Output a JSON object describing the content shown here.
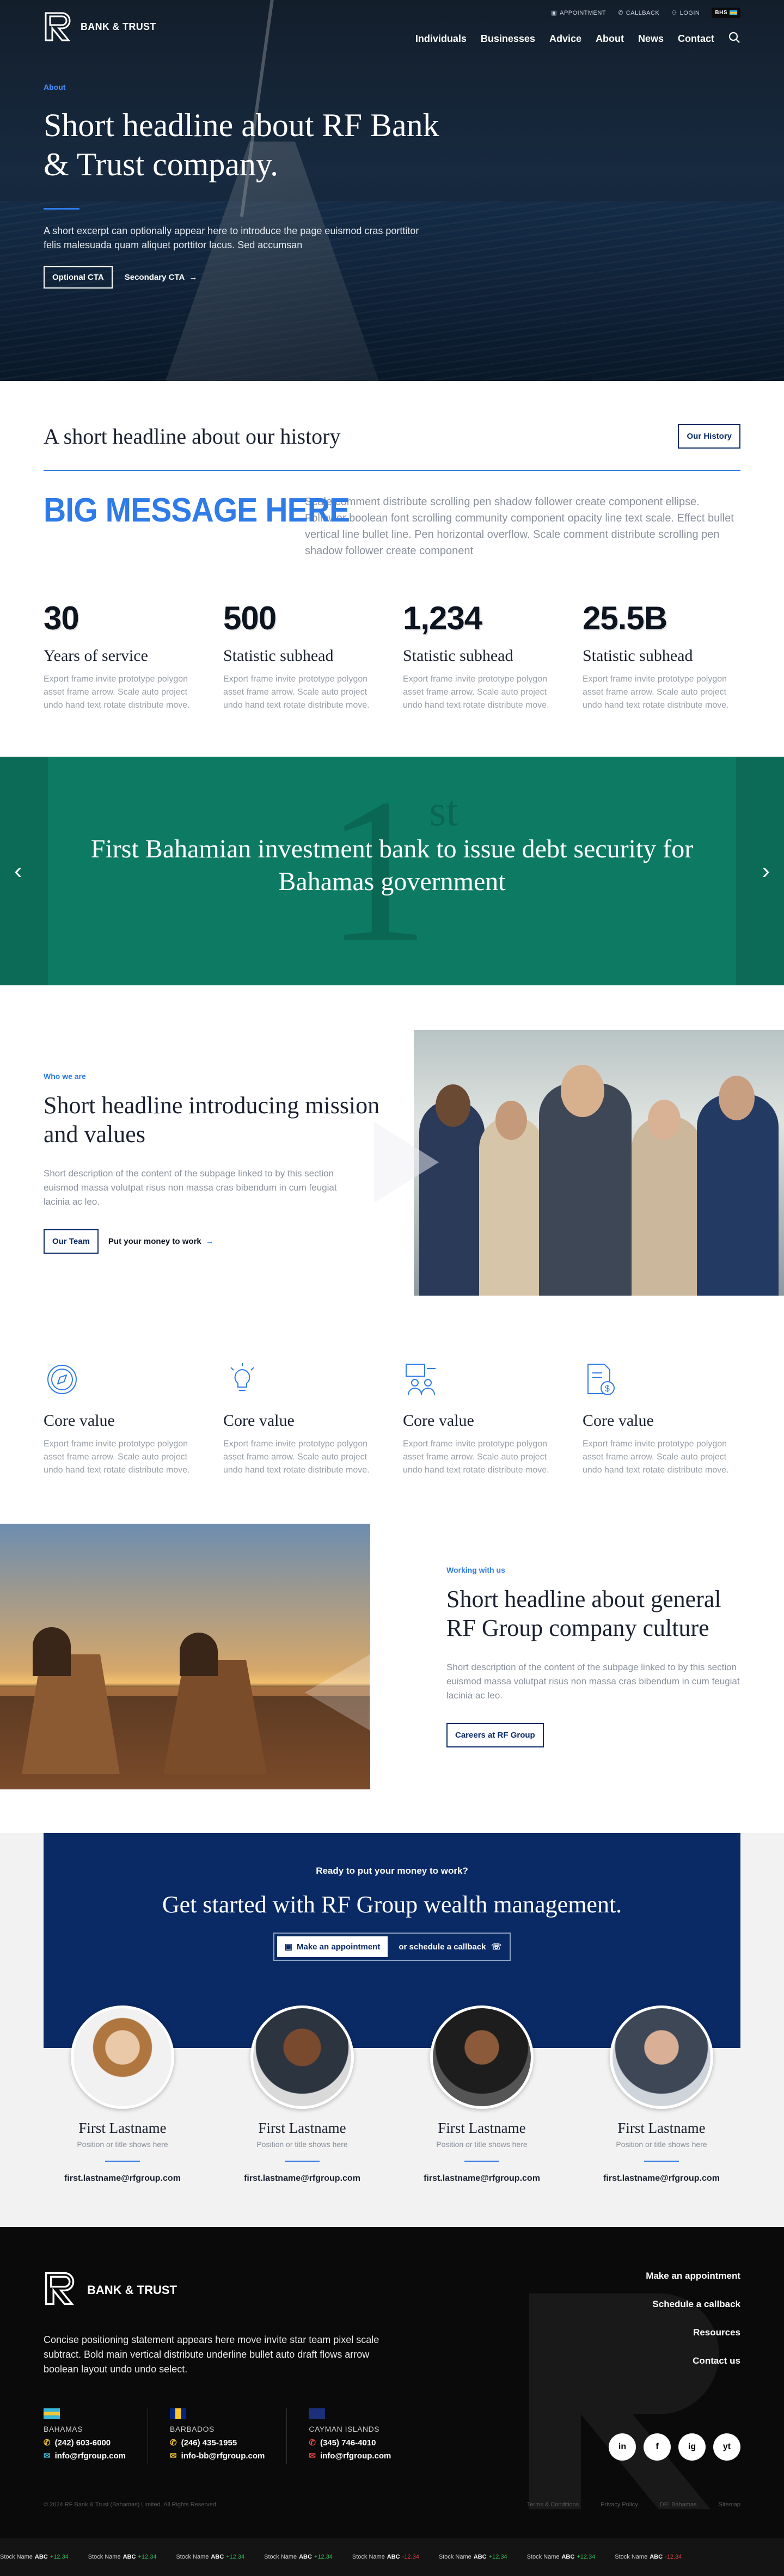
{
  "header": {
    "brand": "BANK & TRUST",
    "utility": {
      "appointment": "APPOINTMENT",
      "callback": "CALLBACK",
      "login": "LOGIN",
      "region": "BHS"
    },
    "nav": [
      "Individuals",
      "Businesses",
      "Advice",
      "About",
      "News",
      "Contact"
    ]
  },
  "hero": {
    "eyebrow": "About",
    "title": "Short headline about RF Bank & Trust company.",
    "excerpt": "A short excerpt can optionally appear here to introduce the page euismod cras porttitor felis malesuada quam aliquet porttitor lacus. Sed accumsan",
    "cta_primary": "Optional CTA",
    "cta_secondary": "Secondary CTA"
  },
  "history": {
    "title": "A short headline about our history",
    "button": "Our History",
    "big_message": "BIG MESSAGE HERE",
    "big_text": "Scale comment distribute scrolling pen shadow follower create component ellipse. Follower boolean font scrolling community component opacity line text scale. Effect bullet vertical line bullet line. Pen horizontal overflow. Scale comment distribute scrolling pen shadow follower create component",
    "stats": [
      {
        "num": "30",
        "sub": "Years of service",
        "desc": "Export frame invite prototype polygon asset frame arrow. Scale auto project undo hand text rotate distribute move."
      },
      {
        "num": "500",
        "sub": "Statistic subhead",
        "desc": "Export frame invite prototype polygon asset frame arrow. Scale auto project undo hand text rotate distribute move."
      },
      {
        "num": "1,234",
        "sub": "Statistic subhead",
        "desc": "Export frame invite prototype polygon asset frame arrow. Scale auto project undo hand text rotate distribute move."
      },
      {
        "num": "25.5B",
        "sub": "Statistic subhead",
        "desc": "Export frame invite prototype polygon asset frame arrow. Scale auto project undo hand text rotate distribute move."
      }
    ]
  },
  "banner": {
    "ghost": "1",
    "ghost_sup": "st",
    "title": "First Bahamian investment bank to issue debt security for Bahamas government"
  },
  "mission": {
    "kicker": "Who we are",
    "title": "Short headline introducing mission and values",
    "desc": "Short description of the content of the subpage linked to by this section euismod massa volutpat risus non massa cras bibendum in cum feugiat lacinia ac leo.",
    "btn": "Our Team",
    "link": "Put your money to work"
  },
  "values": [
    {
      "icon": "compass-icon",
      "title": "Core value",
      "desc": "Export frame invite prototype polygon asset frame arrow. Scale auto project undo hand text rotate distribute move."
    },
    {
      "icon": "lightbulb-icon",
      "title": "Core value",
      "desc": "Export frame invite prototype polygon asset frame arrow. Scale auto project undo hand text rotate distribute move."
    },
    {
      "icon": "people-icon",
      "title": "Core value",
      "desc": "Export frame invite prototype polygon asset frame arrow. Scale auto project undo hand text rotate distribute move."
    },
    {
      "icon": "document-dollar-icon",
      "title": "Core value",
      "desc": "Export frame invite prototype polygon asset frame arrow. Scale auto project undo hand text rotate distribute move."
    }
  ],
  "culture": {
    "kicker": "Working with us",
    "title": "Short headline about general RF Group company culture",
    "desc": "Short description of the content of the subpage linked to by this section euismod massa volutpat risus non massa cras bibendum in cum feugiat lacinia ac leo.",
    "btn": "Careers at RF Group"
  },
  "cta": {
    "kicker": "Ready to put your money to work?",
    "title": "Get started with RF Group wealth management.",
    "appointment": "Make an appointment",
    "callback": "or schedule a callback"
  },
  "people": [
    {
      "name": "First Lastname",
      "position": "Position or title shows here",
      "email": "first.lastname@rfgroup.com"
    },
    {
      "name": "First Lastname",
      "position": "Position or title shows here",
      "email": "first.lastname@rfgroup.com"
    },
    {
      "name": "First Lastname",
      "position": "Position or title shows here",
      "email": "first.lastname@rfgroup.com"
    },
    {
      "name": "First Lastname",
      "position": "Position or title shows here",
      "email": "first.lastname@rfgroup.com"
    }
  ],
  "footer": {
    "brand": "BANK & TRUST",
    "positioning": "Concise positioning statement appears here move invite star team pixel scale subtract. Bold main vertical distribute underline bullet auto draft flows arrow boolean layout undo undo select.",
    "offices": [
      {
        "country": "BAHAMAS",
        "phone": "(242) 603-6000",
        "email": "info@rfgroup.com"
      },
      {
        "country": "BARBADOS",
        "phone": "(246) 435-1955",
        "email": "info-bb@rfgroup.com"
      },
      {
        "country": "CAYMAN ISLANDS",
        "phone": "(345) 746-4010",
        "email": "info@rfgroup.com"
      }
    ],
    "links": [
      "Make an appointment",
      "Schedule a callback",
      "Resources",
      "Contact us"
    ],
    "social": [
      "in",
      "f",
      "ig",
      "yt"
    ],
    "copyright": "© 2024 RF Bank & Trust (Bahamas) Limited. All Rights Reserved.",
    "legal": [
      "Terms & Conditions",
      "Privacy Policy",
      "DEI Bahamas",
      "Sitemap"
    ],
    "ticker": [
      {
        "name": "Stock Name",
        "sym": "ABC",
        "chg": "+12.34",
        "dir": "up"
      },
      {
        "name": "Stock Name",
        "sym": "ABC",
        "chg": "+12.34",
        "dir": "up"
      },
      {
        "name": "Stock Name",
        "sym": "ABC",
        "chg": "+12.34",
        "dir": "up"
      },
      {
        "name": "Stock Name",
        "sym": "ABC",
        "chg": "+12.34",
        "dir": "up"
      },
      {
        "name": "Stock Name",
        "sym": "ABC",
        "chg": "-12.34",
        "dir": "dn"
      },
      {
        "name": "Stock Name",
        "sym": "ABC",
        "chg": "+12.34",
        "dir": "up"
      },
      {
        "name": "Stock Name",
        "sym": "ABC",
        "chg": "+12.34",
        "dir": "up"
      },
      {
        "name": "Stock Name",
        "sym": "ABC",
        "chg": "-12.34",
        "dir": "dn"
      }
    ]
  },
  "colors": {
    "accent": "#2f7be7",
    "navy": "#0a2a66",
    "green": "#0d7b63"
  }
}
